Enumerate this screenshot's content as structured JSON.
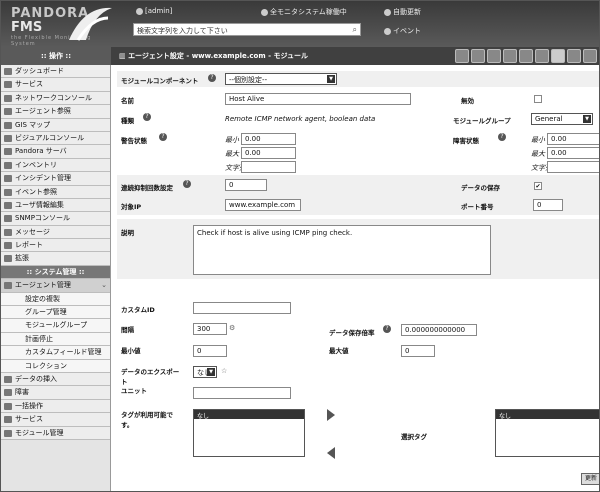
{
  "header": {
    "logo_line1": "PANDORA",
    "logo_line2": "FMS",
    "logo_line3": "the Flexible Monitoring System",
    "user": "[admin]",
    "system_status": "全モニタシステム稼働中",
    "refresh": "自動更新",
    "search_placeholder": "検索文字列を入力して下さい",
    "events": "イベント"
  },
  "toolbar": {
    "sidebar_title": ":: 操作 ::",
    "breadcrumb": "エージェント設定 - www.example.com - モジュール",
    "icons": [
      "tool-a-icon",
      "tool-b-icon",
      "tool-c-icon",
      "tool-d-icon",
      "tool-e-icon",
      "tool-f-icon",
      "tool-g-icon",
      "tool-h-icon",
      "tool-i-icon"
    ]
  },
  "sidebar": {
    "items": [
      {
        "label": "ダッシュボード",
        "type": "item"
      },
      {
        "label": "サービス",
        "type": "item"
      },
      {
        "label": "ネットワークコンソール",
        "type": "item"
      },
      {
        "label": "エージェント参照",
        "type": "item"
      },
      {
        "label": "GIS マップ",
        "type": "item"
      },
      {
        "label": "ビジュアルコンソール",
        "type": "item"
      },
      {
        "label": "Pandora サーバ",
        "type": "item"
      },
      {
        "label": "インベントリ",
        "type": "item"
      },
      {
        "label": "インシデント管理",
        "type": "item"
      },
      {
        "label": "イベント参照",
        "type": "item"
      },
      {
        "label": "ユーザ情報編集",
        "type": "item"
      },
      {
        "label": "SNMPコンソール",
        "type": "item"
      },
      {
        "label": "メッセージ",
        "type": "item"
      },
      {
        "label": "レポート",
        "type": "item"
      },
      {
        "label": "拡張",
        "type": "item"
      },
      {
        "label": ":: システム管理 ::",
        "type": "section"
      },
      {
        "label": "エージェント管理",
        "type": "item-open"
      },
      {
        "label": "設定の複製",
        "type": "sub"
      },
      {
        "label": "グループ管理",
        "type": "sub"
      },
      {
        "label": "モジュールグループ",
        "type": "sub"
      },
      {
        "label": "計画停止",
        "type": "sub"
      },
      {
        "label": "カスタムフィールド管理",
        "type": "sub"
      },
      {
        "label": "コレクション",
        "type": "sub"
      },
      {
        "label": "データの挿入",
        "type": "item"
      },
      {
        "label": "障害",
        "type": "item"
      },
      {
        "label": "一括操作",
        "type": "item"
      },
      {
        "label": "サービス",
        "type": "item"
      },
      {
        "label": "モジュール管理",
        "type": "item"
      }
    ]
  },
  "form": {
    "component_label": "モジュールコンポーネント",
    "component_value": "--個別設定--",
    "name_label": "名前",
    "name_value": "Host Alive",
    "disabled_label": "無効",
    "type_label": "種類",
    "type_value": "Remote ICMP network agent, boolean data",
    "module_group_label": "モジュールグループ",
    "module_group_value": "General",
    "warning_label": "警告状態",
    "critical_label": "障害状態",
    "min_label": "最小",
    "max_label": "最大",
    "str_label": "文字列",
    "warn_min": "0.00",
    "warn_max": "0.00",
    "crit_min": "0.00",
    "crit_max": "0.00",
    "ff_label": "連続抑制回数設定",
    "ff_value": "0",
    "historical_label": "データの保存",
    "historical_check": "✔",
    "target_ip_label": "対象IP",
    "target_ip_value": "www.example.com",
    "port_label": "ポート番号",
    "port_value": "0",
    "desc_label": "説明",
    "desc_value": "Check if host is alive using ICMP ping check.",
    "custom_id_label": "カスタムID",
    "interval_label": "間隔",
    "interval_value": "300",
    "post_process_label": "データ保存倍率",
    "post_process_value": "0.000000000000",
    "min_value_label": "最小値",
    "min_value": "0",
    "max_value_label": "最大値",
    "max_value": "0",
    "export_label": "データのエクスポート",
    "export_value": "なし",
    "unit_label": "ユニット",
    "tags_available_label": "タグが利用可能です。",
    "tags_available_head": "なし",
    "tags_selected_label": "選択タグ",
    "tags_selected_head": "なし",
    "update_button": "更新"
  }
}
